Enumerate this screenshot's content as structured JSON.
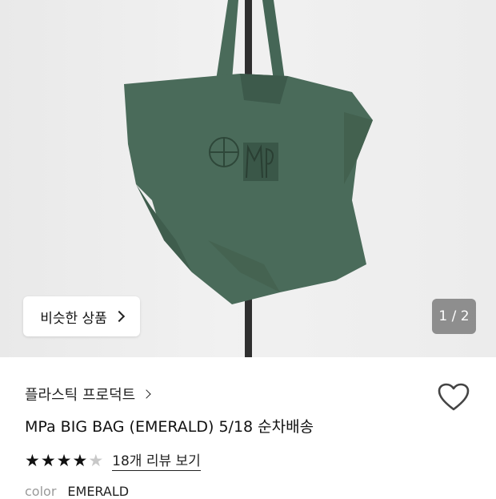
{
  "similar_button": {
    "label": "비슷한 상품"
  },
  "pager": {
    "text": "1 / 2"
  },
  "brand": {
    "name": "플라스틱 프로덕트"
  },
  "product": {
    "title": "MPa BIG BAG (EMERALD) 5/18 순차배송"
  },
  "rating": {
    "stars_filled": 4,
    "stars_total": 5,
    "review_link": "18개 리뷰 보기"
  },
  "option": {
    "label": "color",
    "value": "EMERALD"
  },
  "colors": {
    "bag": "#4a6b5a",
    "bag_dark": "#3d5a4b",
    "accent": "#222222"
  }
}
